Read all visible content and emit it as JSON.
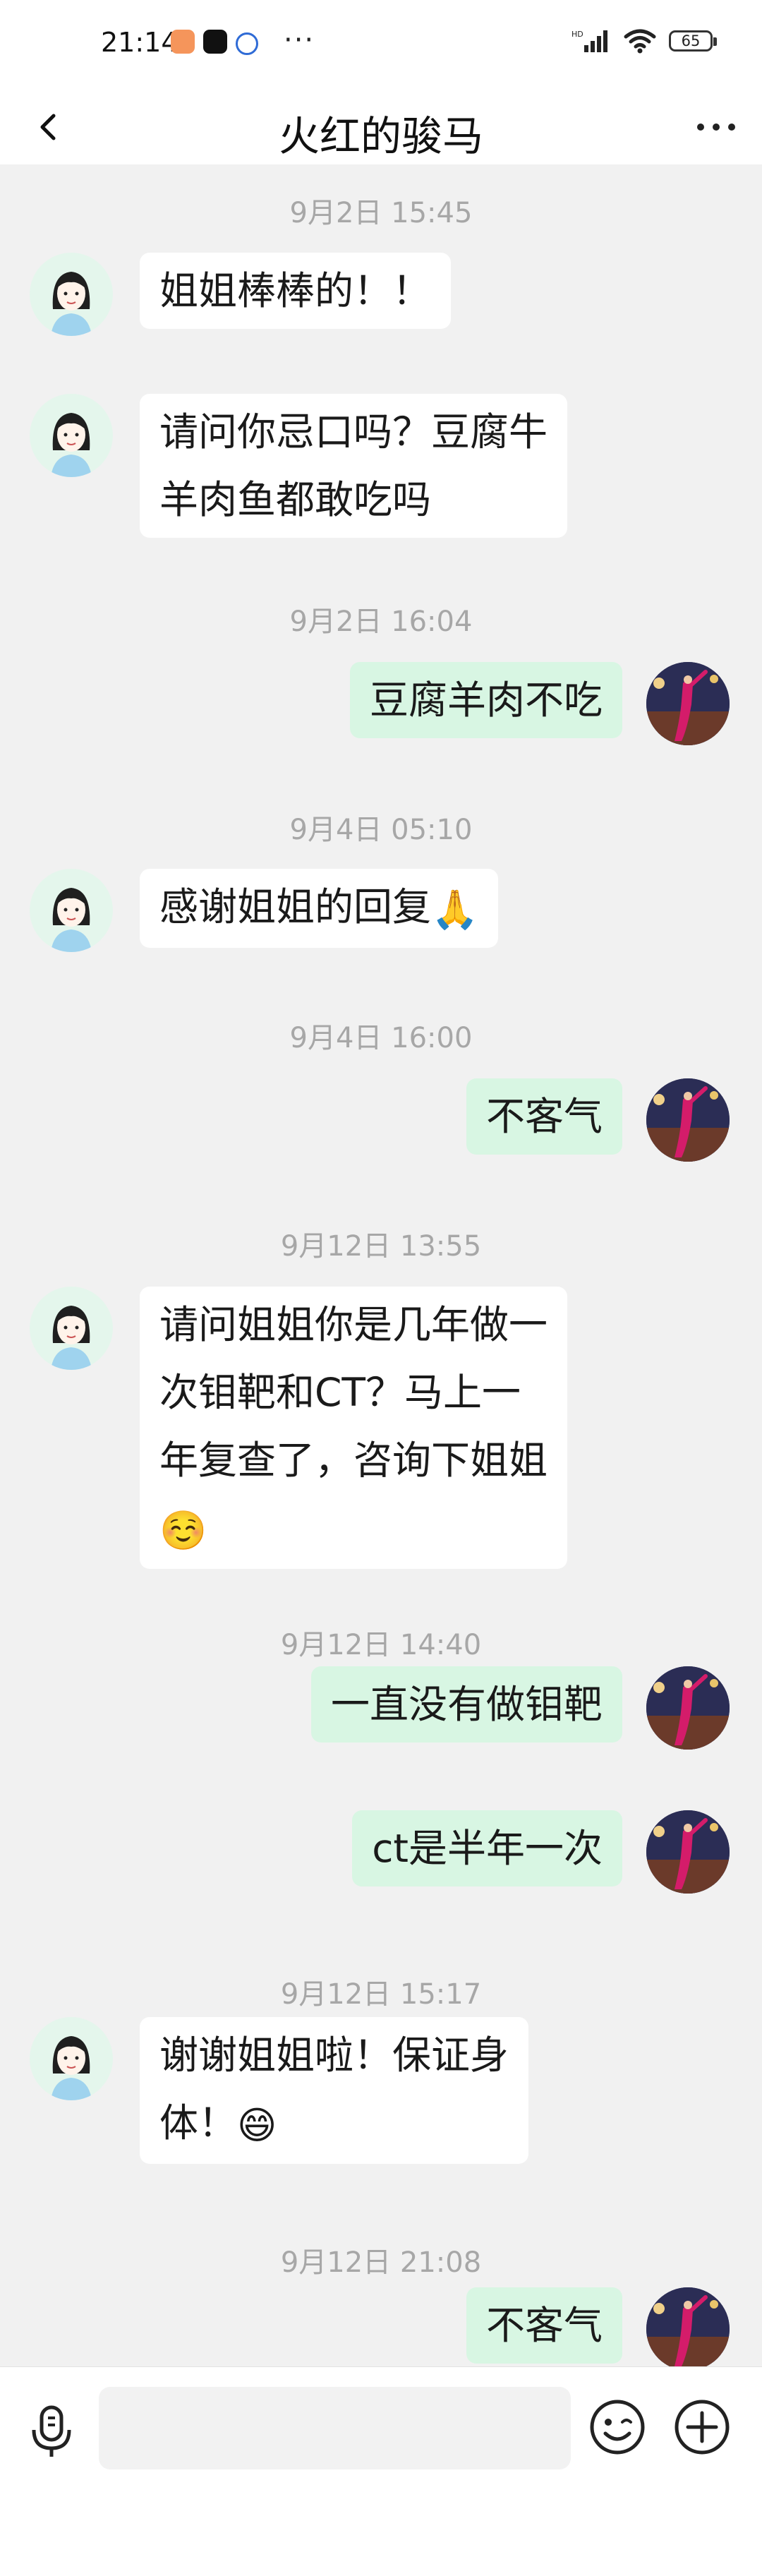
{
  "status_bar": {
    "time": "21:14",
    "signal": "HD",
    "battery": "65"
  },
  "nav": {
    "title": "火红的骏马"
  },
  "messages": [
    {
      "type": "time",
      "text": "9月2日 15:45"
    },
    {
      "type": "msg",
      "side": "left",
      "lines": [
        "姐姐棒棒的！！"
      ]
    },
    {
      "type": "msg",
      "side": "left",
      "lines": [
        "请问你忌口吗？豆腐牛",
        "羊肉鱼都敢吃吗"
      ]
    },
    {
      "type": "time",
      "text": "9月2日 16:04"
    },
    {
      "type": "msg",
      "side": "right",
      "lines": [
        "豆腐羊肉不吃"
      ]
    },
    {
      "type": "time",
      "text": "9月4日 05:10"
    },
    {
      "type": "msg",
      "side": "left",
      "lines": [
        "感谢姐姐的回复"
      ],
      "emoji": "🙏"
    },
    {
      "type": "time",
      "text": "9月4日 16:00"
    },
    {
      "type": "msg",
      "side": "right",
      "lines": [
        "不客气"
      ]
    },
    {
      "type": "time",
      "text": "9月12日 13:55"
    },
    {
      "type": "msg",
      "side": "left",
      "lines": [
        "请问姐姐你是几年做一",
        "次钼靶和CT？马上一",
        "年复查了，咨询下姐姐"
      ],
      "emoji": "☺️"
    },
    {
      "type": "time",
      "text": "9月12日 14:40"
    },
    {
      "type": "msg",
      "side": "right",
      "lines": [
        "一直没有做钼靶"
      ]
    },
    {
      "type": "msg",
      "side": "right",
      "lines": [
        "ct是半年一次"
      ]
    },
    {
      "type": "time",
      "text": "9月12日 15:17"
    },
    {
      "type": "msg",
      "side": "left",
      "lines": [
        "谢谢姐姐啦！保证身",
        "体！"
      ],
      "emoji": "😄"
    },
    {
      "type": "time",
      "text": "9月12日 21:08"
    },
    {
      "type": "msg",
      "side": "right",
      "lines": [
        "不客气"
      ]
    }
  ],
  "input_bar": {
    "placeholder": ""
  },
  "colors": {
    "background": "#f1f1f1",
    "bubble_left": "#ffffff",
    "bubble_right": "#d8f6e3",
    "timestamp": "#a7a7a7"
  }
}
